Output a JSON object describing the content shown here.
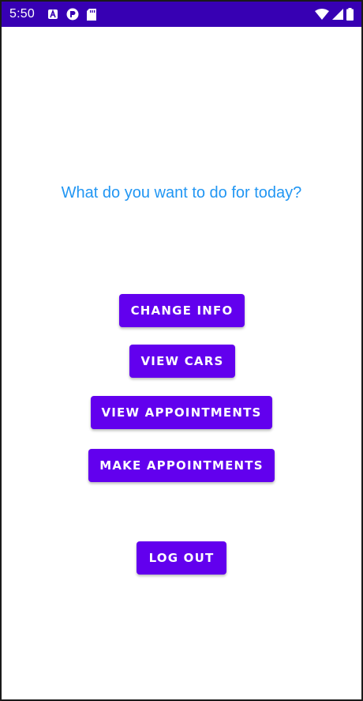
{
  "status_bar": {
    "time": "5:50",
    "background_color": "#3700b3",
    "left_icons": [
      "android-a-icon",
      "sync-circle-icon",
      "sd-card-icon"
    ],
    "right_icons": [
      "wifi-icon",
      "cell-signal-icon",
      "battery-icon"
    ]
  },
  "main": {
    "question": "What do you want to do for today?",
    "question_color": "#2196f3",
    "accent_color": "#6200ee",
    "buttons": {
      "change_info": "CHANGE INFO",
      "view_cars": "VIEW CARS",
      "view_appointments": "VIEW APPOINTMENTS",
      "make_appointments": "MAKE APPOINTMENTS",
      "log_out": "LOG OUT"
    }
  }
}
